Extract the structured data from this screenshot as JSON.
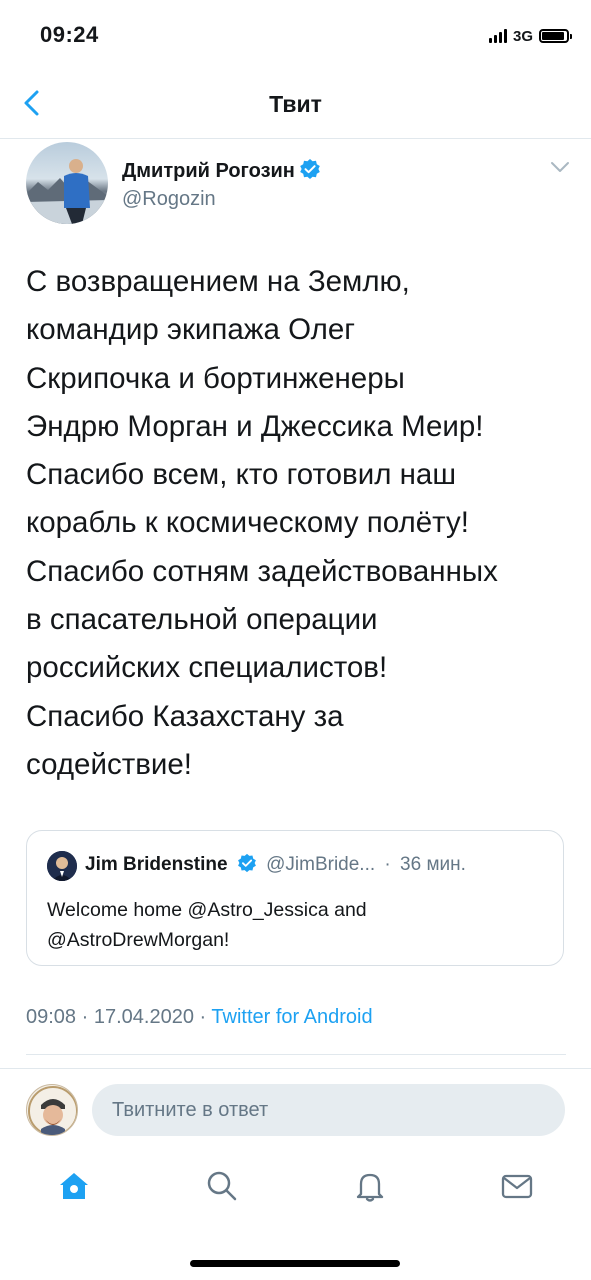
{
  "status_bar": {
    "time": "09:24",
    "network": "3G"
  },
  "nav": {
    "title": "Твит"
  },
  "tweet": {
    "author_name": "Дмитрий Рогозин",
    "author_handle": "@Rogozin",
    "text": "С возвращением на Землю,\nкомандир экипажа Олег\nСкрипочка и бортинженеры\nЭндрю Морган и Джессика Меир!\nСпасибо всем, кто готовил наш\nкорабль к космическому полёту!\nСпасибо сотням задействованных\nв спасательной операции\nроссийских специалистов!\nСпасибо Казахстану за\nсодействие!",
    "time": "09:08",
    "date": "17.04.2020",
    "source": "Twitter for Android",
    "separator": "·"
  },
  "quoted_tweet": {
    "author_name": "Jim Bridenstine",
    "author_handle": "@JimBride...",
    "time_ago": "36 мин.",
    "separator": "·",
    "text": "Welcome home @Astro_Jessica and\n@AstroDrewMorgan!"
  },
  "reply": {
    "placeholder": "Твитните в ответ"
  },
  "colors": {
    "accent": "#1da1f2",
    "secondary_text": "#657786",
    "divider": "#e1e8ed"
  },
  "icons": {
    "back": "chevron-left-icon",
    "verified": "verified-badge-icon",
    "menu": "chevron-down-icon",
    "tabs": [
      "home-icon",
      "search-icon",
      "notifications-icon",
      "messages-icon"
    ]
  }
}
